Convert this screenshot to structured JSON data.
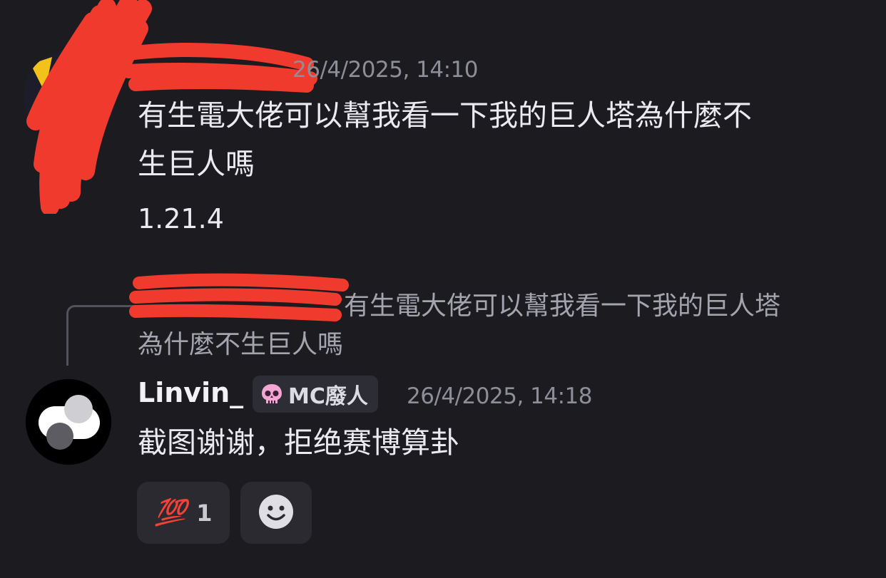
{
  "message1": {
    "author": "",
    "timestamp": "26/4/2025, 14:10",
    "text": "有生電大佬可以幫我看一下我的巨人塔為什麼不生巨人嗎",
    "text_line1": "有生電大佬可以幫我看一下我的巨人塔為什麼不",
    "text_line2": "生巨人嗎",
    "attachment_text": "1.21.4"
  },
  "reply_preview": {
    "line1": "有生電大佬可以幫我看一下我的巨人塔",
    "line2": "為什麼不生巨人嗎"
  },
  "message2": {
    "author": "Linvin_",
    "role_tag": "MC廢人",
    "timestamp": "26/4/2025, 14:18",
    "text": "截图谢谢，拒绝赛博算卦"
  },
  "reactions": [
    {
      "emoji": "💯",
      "count": "1"
    }
  ],
  "icons": {
    "role_icon": "skull-icon",
    "add_reaction": "smiley-face-icon"
  },
  "colors": {
    "background": "#1b1b20",
    "timestamp": "#8d8e97",
    "redaction": "#f03a2e"
  }
}
